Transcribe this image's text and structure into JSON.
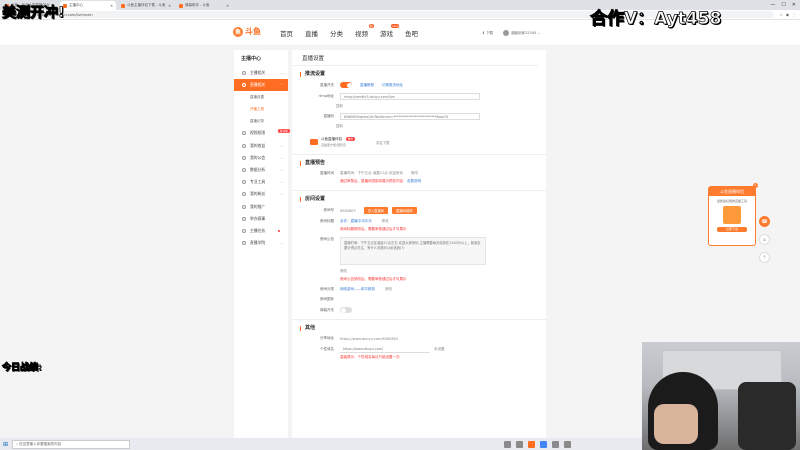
{
  "browser": {
    "tabs": [
      {
        "label": "斗鱼 - 每个人的直播平台"
      },
      {
        "label": "主播中心"
      },
      {
        "label": "斗鱼主播伴侣下载 - 斗鱼"
      },
      {
        "label": "弹幕助手 - 斗鱼"
      }
    ],
    "active_tab": 1,
    "url": "https://mp.douyu.com/live/main",
    "win_controls": [
      "—",
      "☐",
      "✕"
    ]
  },
  "site": {
    "logo_text": "斗鱼",
    "nav": [
      {
        "label": "首页",
        "badge": ""
      },
      {
        "label": "直播",
        "badge": ""
      },
      {
        "label": "分类",
        "badge": ""
      },
      {
        "label": "视频",
        "badge": "新"
      },
      {
        "label": "游戏",
        "badge": "new"
      },
      {
        "label": "鱼吧",
        "badge": ""
      }
    ],
    "header_right": {
      "download": "下载",
      "user": "超级玩家12345"
    }
  },
  "sidebar": {
    "title": "主播中心",
    "items": [
      {
        "label": "主播相关",
        "active": false,
        "tag": ""
      },
      {
        "label": "直播相关",
        "active": true,
        "tag": ""
      },
      {
        "label": "直播设置",
        "sub": true,
        "current": false
      },
      {
        "label": "开播工具",
        "sub": true,
        "current": true
      },
      {
        "label": "直播记录",
        "sub": true,
        "current": false
      },
      {
        "label": "视频权限",
        "active": false,
        "tag": "新功能"
      },
      {
        "label": "我的收益",
        "active": false,
        "tag": ""
      },
      {
        "label": "我的公会",
        "active": false,
        "tag": ""
      },
      {
        "label": "数据分析",
        "active": false,
        "tag": ""
      },
      {
        "label": "专业工具",
        "active": false,
        "tag": ""
      },
      {
        "label": "我的粉丝",
        "active": false,
        "tag": ""
      },
      {
        "label": "我的推广",
        "active": false,
        "tag": ""
      },
      {
        "label": "举办赛事",
        "active": false,
        "tag": ""
      },
      {
        "label": "主播任务",
        "active": false,
        "tag": "dot"
      },
      {
        "label": "直播学院",
        "active": false,
        "tag": ""
      }
    ]
  },
  "main": {
    "title": "直播设置",
    "stream": {
      "section": "推流设置",
      "switch_label": "直播开关",
      "link1": "直播教程",
      "link2": "切换推流地址",
      "rtmp_label": "rtmp地址",
      "rtmp_value": "rtmp://sendtc3.douyu.com/live",
      "copy1": "复制",
      "code_label": "直播码",
      "code_value": "6560803rqnhaQhrTwsSecret=**************************8ww70",
      "copy2": "复制",
      "tool_title": "斗鱼直播伴侣",
      "tool_sub": "直播更方便/更稳定",
      "tool_badge": "推荐",
      "tool_link": "前往下载"
    },
    "notice": {
      "section": "直播预告",
      "label": "直播时间",
      "value": "直播时间：下午五点-凌晨12点 欢迎来玩",
      "edit": "修改",
      "warn": "通过审核后，直播间顶部将展示预告内容",
      "link": "查看说明"
    },
    "room": {
      "section": "房间设置",
      "room_id_label": "房间号",
      "room_id": "6560803",
      "btn1": "进入直播间",
      "btn2": "直播间装修",
      "title_label": "房间标题",
      "title_value": "合作：直播中冲冲冲",
      "title_edit": "修改",
      "title_warn": "房间标题修改后，需要审核通过后才可展示",
      "notice_label": "房间公告",
      "notice_text": "直播时间：下午五点至凌晨12点左右 欢迎大家来玩 主播需要每天保持在1200分以上，新朋友要记得点关注，有什么问题可以私信我(?)",
      "notice_edit": "修改",
      "notice_warn": "房间公告修改后，需要审核通过后才可展示",
      "cat_label": "房间分类",
      "cat_value": "网络游戏——和平精英",
      "cat_edit": "修改",
      "pic_label": "房间图标",
      "danmu_label": "弹幕开关"
    },
    "other": {
      "section": "其他",
      "share_label": "分享地址",
      "share_value": "https://www.douyu.com/6560803",
      "custom_label": "个性域名",
      "custom_value": "https://www.douyu.com/",
      "custom_suffix": "未设置",
      "custom_warn": "温馨提示：个性域名每月只能设置一次"
    }
  },
  "promo": {
    "header": "斗鱼直播伴侣",
    "text": "最新最好用的直播工具",
    "btn": "立即下载",
    "close": "×"
  },
  "taskbar": {
    "search": "在这里输入你要搜索的内容"
  },
  "overlays": {
    "left": "美测开冲!",
    "right": "合作V：Ayt458",
    "today": "今日战绩:"
  }
}
